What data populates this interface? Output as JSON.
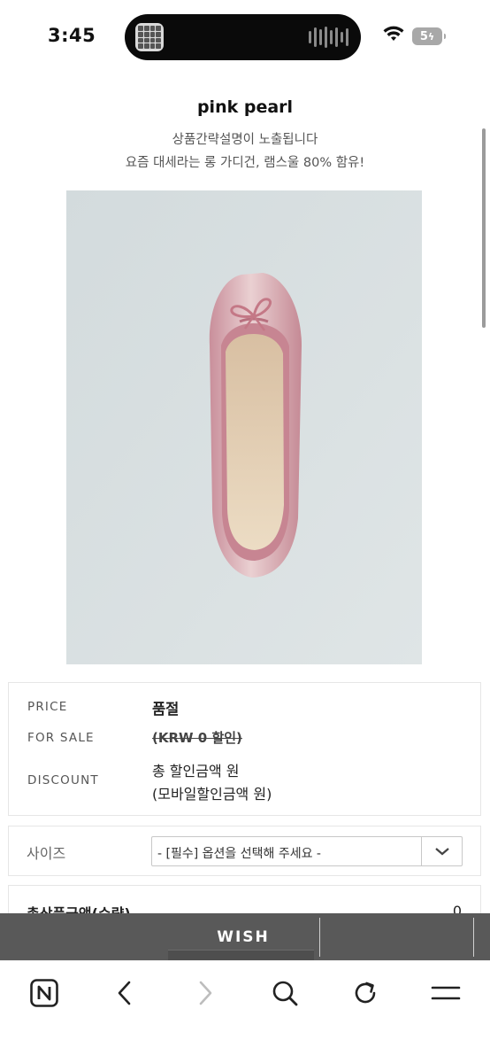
{
  "status_bar": {
    "time": "3:45",
    "battery": "5"
  },
  "product": {
    "title": "pink pearl",
    "summary_line1": "상품간략설명이 노출됩니다",
    "summary_line2": "요즘 대세라는 롱 가디건, 램스울 80% 함유!"
  },
  "info": {
    "price_label": "PRICE",
    "price_value": "품절",
    "sale_label": "FOR SALE",
    "sale_value": "(KRW 0 할인)",
    "discount_label": "DISCOUNT",
    "discount_value_1": "총 할인금액 원",
    "discount_value_2": "(모바일할인금액 원)"
  },
  "option": {
    "label": "사이즈",
    "selected": "- [필수] 옵션을 선택해 주세요 -"
  },
  "total": {
    "label": "총상품금액(수량)",
    "value": "0"
  },
  "wish": {
    "label": "WISH"
  },
  "colors": {
    "wish_bar": "#595959",
    "image_bg": "#d9e0e1",
    "shoe_pink": "#d9a0aa"
  },
  "icons": [
    "naver-icon",
    "back-icon",
    "forward-icon",
    "search-icon",
    "reload-icon",
    "menu-icon"
  ]
}
